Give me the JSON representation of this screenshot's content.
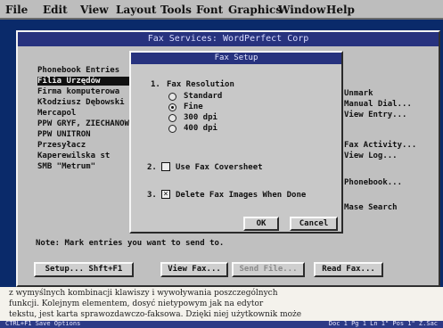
{
  "menubar": {
    "items": [
      "File",
      "Edit",
      "View",
      "Layout",
      "Tools",
      "Font",
      "Graphics",
      "Window",
      "Help"
    ]
  },
  "dialog": {
    "title": "Fax Services: WordPerfect Corp",
    "phonebook": [
      "Phonebook Entries",
      "Filia Urzędów",
      "Firma komputerowa",
      "Kłodziusz Dębowski",
      "Mercapol",
      "PPW GRYF, ZIECHANÓW",
      "PPW UNITRON",
      "Przesyłacz",
      "Kaperewilska st",
      "SMB \"Metrum\""
    ],
    "actions": [
      "Unmark",
      "Manual Dial...",
      "View Entry...",
      "Fax Activity...",
      "View Log...",
      "Phonebook...",
      "Mase Search"
    ],
    "note": "Note: Mark entries you want to send to.",
    "buttons": {
      "setup": "Setup... Shft+F1",
      "view_fax": "View Fax...",
      "send_file": "Send File...",
      "read_fax": "Read Fax..."
    }
  },
  "fax_setup": {
    "title": "Fax Setup",
    "resolution": {
      "num": "1.",
      "label": "Fax Resolution",
      "options": [
        "Standard",
        "Fine",
        "300 dpi",
        "400 dpi"
      ],
      "selected": "Fine"
    },
    "coversheet": {
      "num": "2.",
      "label": "Use Fax Coversheet",
      "checked": false
    },
    "delete_images": {
      "num": "3.",
      "label": "Delete Fax Images When Done",
      "checked": true
    },
    "ok_label": "OK",
    "cancel_label": "Cancel"
  },
  "article": {
    "lines": [
      "z wymyślnych kombinacji klawiszy i wywoływania poszczególnych",
      "funkcji. Kolejnym elementem, dosyć nietypowym jak na edytor",
      "tekstu, jest karta sprawozdawczo-faksowa. Dzięki niej użytkownik może"
    ]
  },
  "status": {
    "left": "CTRL+F1 Save Options",
    "right": "Doc 1 Pg 1 Ln 1\" Pos 1\" Z.Sac"
  }
}
